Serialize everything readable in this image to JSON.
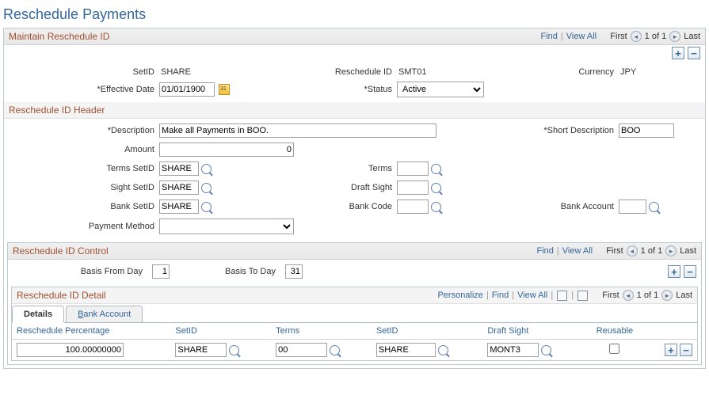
{
  "page_title": "Reschedule Payments",
  "maintain": {
    "title": "Maintain Reschedule ID",
    "links": {
      "find": "Find",
      "view_all": "View All",
      "first": "First",
      "last": "Last",
      "of": "1 of 1"
    },
    "setid_label": "SetID",
    "setid": "SHARE",
    "reschedule_id_label": "Reschedule ID",
    "reschedule_id": "SMT01",
    "currency_label": "Currency",
    "currency": "JPY",
    "effective_date_label": "Effective Date",
    "effective_date": "01/01/1900",
    "status_label": "Status",
    "status": "Active"
  },
  "header": {
    "title": "Reschedule ID Header",
    "description_label": "Description",
    "description": "Make all Payments in BOO.",
    "short_desc_label": "Short Description",
    "short_desc": "BOO",
    "amount_label": "Amount",
    "amount": "0",
    "terms_setid_label": "Terms SetID",
    "terms_setid": "SHARE",
    "terms_label": "Terms",
    "terms": "",
    "sight_setid_label": "Sight SetID",
    "sight_setid": "SHARE",
    "draft_sight_label": "Draft Sight",
    "draft_sight": "",
    "bank_setid_label": "Bank SetID",
    "bank_setid": "SHARE",
    "bank_code_label": "Bank Code",
    "bank_code": "",
    "bank_account_label": "Bank Account",
    "bank_account": "",
    "payment_method_label": "Payment Method",
    "payment_method": ""
  },
  "control": {
    "title": "Reschedule ID Control",
    "links": {
      "find": "Find",
      "view_all": "View All",
      "first": "First",
      "last": "Last",
      "of": "1 of 1"
    },
    "basis_from_label": "Basis From Day",
    "basis_from": "1",
    "basis_to_label": "Basis To Day",
    "basis_to": "31"
  },
  "detail": {
    "title": "Reschedule ID Detail",
    "links": {
      "personalize": "Personalize",
      "find": "Find",
      "view_all": "View All",
      "first": "First",
      "last": "Last",
      "of": "1 of 1"
    },
    "tabs": {
      "details": "Details",
      "bank_account_prefix": "B",
      "bank_account_rest": "ank Account"
    },
    "columns": {
      "pct": "Reschedule Percentage",
      "setid1": "SetID",
      "terms": "Terms",
      "setid2": "SetID",
      "draft_sight": "Draft Sight",
      "reusable": "Reusable"
    },
    "row": {
      "pct": "100.00000000",
      "setid1": "SHARE",
      "terms": "00",
      "setid2": "SHARE",
      "draft_sight": "MONT3",
      "reusable": false
    }
  }
}
